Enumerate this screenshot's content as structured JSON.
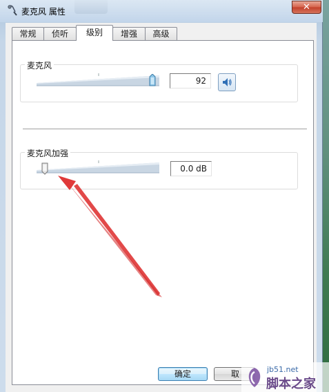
{
  "window": {
    "title": "麦克风 属性",
    "close_glyph": "✕"
  },
  "tabs": [
    {
      "label": "常规",
      "active": false
    },
    {
      "label": "侦听",
      "active": false
    },
    {
      "label": "级别",
      "active": true
    },
    {
      "label": "增强",
      "active": false
    },
    {
      "label": "高级",
      "active": false
    }
  ],
  "microphone": {
    "label": "麦克风",
    "value": "92",
    "level_fraction": 0.92,
    "mute_icon": "speaker-icon"
  },
  "boost": {
    "label": "麦克风加强",
    "value": "0.0 dB",
    "level_fraction": 0.0
  },
  "buttons": {
    "ok": "确定",
    "cancel": "取"
  },
  "watermark": {
    "url": "jb51.net",
    "name": "脚本之家"
  },
  "colors": {
    "annotation_arrow": "#e03a3a",
    "close_button": "#c84630",
    "default_button_border": "#3c7fb1"
  }
}
